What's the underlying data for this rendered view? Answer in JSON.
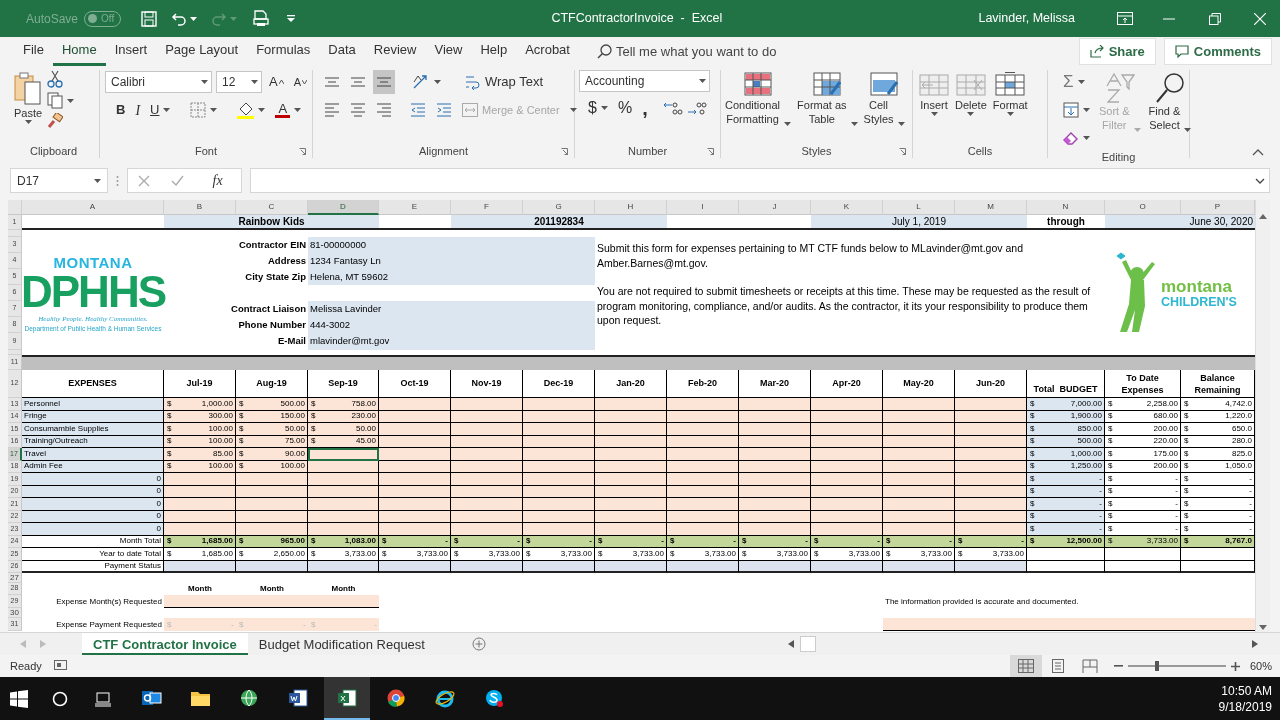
{
  "title_bar": {
    "autosave_label": "AutoSave",
    "autosave_toggle": "Off",
    "autosave_on": false,
    "title": "CTFContractorInvoice  -  Excel",
    "user": "Lavinder, Melissa"
  },
  "ribbon_tabs": [
    {
      "label": "File",
      "selected": false
    },
    {
      "label": "Home",
      "selected": true
    },
    {
      "label": "Insert",
      "selected": false
    },
    {
      "label": "Page Layout",
      "selected": false
    },
    {
      "label": "Formulas",
      "selected": false
    },
    {
      "label": "Data",
      "selected": false
    },
    {
      "label": "Review",
      "selected": false
    },
    {
      "label": "View",
      "selected": false
    },
    {
      "label": "Help",
      "selected": false
    },
    {
      "label": "Acrobat",
      "selected": false
    }
  ],
  "tell_me": {
    "placeholder": "Tell me what you want to do"
  },
  "share": "Share",
  "comments": "Comments",
  "clipboard": {
    "paste": "Paste",
    "label": "Clipboard"
  },
  "font": {
    "name": "Calibri",
    "size": "12",
    "grow": "A",
    "shrink": "A",
    "bold": "B",
    "italic": "I",
    "underline": "U",
    "color_letter": "A",
    "label": "Font"
  },
  "alignment": {
    "vertical": [
      {
        "selected": false
      },
      {
        "selected": false
      },
      {
        "selected": true
      }
    ],
    "wrap_text": "Wrap Text",
    "merge_center": {
      "label": "Merge & Center",
      "disabled": true
    },
    "label": "Alignment"
  },
  "number": {
    "format": "Accounting",
    "currency": "$",
    "percent": "%",
    "comma": ",",
    "label": "Number"
  },
  "styles": {
    "buttons": [
      {
        "kind": "conditional",
        "lines": [
          "Conditional",
          "Formatting"
        ]
      },
      {
        "kind": "table",
        "lines": [
          "Format as",
          "Table"
        ]
      },
      {
        "kind": "cell",
        "lines": [
          "Cell",
          "Styles"
        ]
      }
    ],
    "label": "Styles"
  },
  "cells": {
    "buttons": [
      {
        "kind": "insert",
        "label": "Insert"
      },
      {
        "kind": "delete",
        "label": "Delete"
      },
      {
        "kind": "format",
        "label": "Format"
      }
    ],
    "label": "Cells"
  },
  "editing": {
    "sum": "Σ",
    "sort_filter": {
      "lines": [
        "Sort &",
        "Filter"
      ],
      "disabled": true
    },
    "find_select": {
      "lines": [
        "Find &",
        "Select"
      ],
      "disabled": false
    },
    "label": "Editing"
  },
  "formula_bar": {
    "name_box": "D17",
    "fx": "fx"
  },
  "columns": [
    {
      "letter": "A",
      "selected": false
    },
    {
      "letter": "B",
      "selected": false
    },
    {
      "letter": "C",
      "selected": false
    },
    {
      "letter": "D",
      "selected": true
    },
    {
      "letter": "E",
      "selected": false
    },
    {
      "letter": "F",
      "selected": false
    },
    {
      "letter": "G",
      "selected": false
    },
    {
      "letter": "H",
      "selected": false
    },
    {
      "letter": "I",
      "selected": false
    },
    {
      "letter": "J",
      "selected": false
    },
    {
      "letter": "K",
      "selected": false
    },
    {
      "letter": "L",
      "selected": false
    },
    {
      "letter": "M",
      "selected": false
    },
    {
      "letter": "N",
      "selected": false
    },
    {
      "letter": "O",
      "selected": false
    },
    {
      "letter": "P",
      "selected": false
    }
  ],
  "row_headers": [
    {
      "label": "1",
      "selected": false
    },
    {
      "label": "3",
      "selected": false
    },
    {
      "label": "4",
      "selected": false
    },
    {
      "label": "5",
      "selected": false
    },
    {
      "label": "6",
      "selected": false
    },
    {
      "label": "7",
      "selected": false
    },
    {
      "label": "8",
      "selected": false
    },
    {
      "label": "9",
      "selected": false
    },
    {
      "label": "11",
      "selected": false
    },
    {
      "label": "12",
      "selected": false
    },
    {
      "label": "13",
      "selected": false
    },
    {
      "label": "14",
      "selected": false
    },
    {
      "label": "15",
      "selected": false
    },
    {
      "label": "16",
      "selected": false
    },
    {
      "label": "17",
      "selected": true
    },
    {
      "label": "18",
      "selected": false
    },
    {
      "label": "19",
      "selected": false
    },
    {
      "label": "20",
      "selected": false
    },
    {
      "label": "21",
      "selected": false
    },
    {
      "label": "22",
      "selected": false
    },
    {
      "label": "23",
      "selected": false
    },
    {
      "label": "24",
      "selected": false
    },
    {
      "label": "25",
      "selected": false
    },
    {
      "label": "26",
      "selected": false
    },
    {
      "label": "27",
      "selected": false
    },
    {
      "label": "28",
      "selected": false
    },
    {
      "label": "29",
      "selected": false
    },
    {
      "label": "30",
      "selected": false
    },
    {
      "label": "31",
      "selected": false
    }
  ],
  "header_row": {
    "organization": "Rainbow Kids",
    "contract_number": "201192834",
    "start_date": "July 1, 2019",
    "through": "through",
    "end_date": "June 30, 2020"
  },
  "dphhs_logo": {
    "top": "MONTANA",
    "main": "DPHHS",
    "tagline": "Healthy People. Healthy Communities.",
    "department": "Department of Public Health & Human Services"
  },
  "contractor_info": [
    {
      "label": "Contractor EIN",
      "value": "81-00000000"
    },
    {
      "label": "Address",
      "value": "1234 Fantasy Ln"
    },
    {
      "label": "City State Zip",
      "value": "Helena, MT 59602"
    },
    {
      "label": "Contract Liaison",
      "value": "Melissa Lavinder"
    },
    {
      "label": "Phone Number",
      "value": "444-3002"
    },
    {
      "label": "E-Mail",
      "value": "mlavinder@mt.gov"
    }
  ],
  "instructions": [
    "Submit this form for expenses pertaining to MT CTF funds below to MLavinder@mt.gov and Amber.Barnes@mt.gov.",
    "You are not required to submit timesheets or receipts at this time. These may be requested as the result of program monitoring, compliance, and/or audits. As the contractor, it its your responsibility to produce them upon request."
  ],
  "childrens_logo": {
    "top": "montana",
    "bottom": "CHILDREN'S"
  },
  "expenses": {
    "header": "EXPENSES",
    "months": [
      "Jul-19",
      "Aug-19",
      "Sep-19",
      "Oct-19",
      "Nov-19",
      "Dec-19",
      "Jan-20",
      "Feb-20",
      "Mar-20",
      "Apr-20",
      "May-20",
      "Jun-20"
    ],
    "budget_header": "Total  BUDGET",
    "to_date_header": "To Date Expenses",
    "balance_header": "Balance Remaining",
    "rows": [
      {
        "kind": "item",
        "name": "Personnel",
        "amounts": [
          [
            "$",
            "1,000.00"
          ],
          [
            "$",
            "500.00"
          ],
          [
            "$",
            "758.00"
          ]
        ],
        "budget": [
          "$",
          "7,000.00"
        ],
        "to_date": [
          "$",
          "2,258.00"
        ],
        "balance": [
          "$",
          "4,742.0"
        ]
      },
      {
        "kind": "item",
        "name": "Fringe",
        "amounts": [
          [
            "$",
            "300.00"
          ],
          [
            "$",
            "150.00"
          ],
          [
            "$",
            "230.00"
          ]
        ],
        "budget": [
          "$",
          "1,900.00"
        ],
        "to_date": [
          "$",
          "680.00"
        ],
        "balance": [
          "$",
          "1,220.0"
        ]
      },
      {
        "kind": "item",
        "name": "Consumamble Supplies",
        "amounts": [
          [
            "$",
            "100.00"
          ],
          [
            "$",
            "50.00"
          ],
          [
            "$",
            "50.00"
          ]
        ],
        "budget": [
          "$",
          "850.00"
        ],
        "to_date": [
          "$",
          "200.00"
        ],
        "balance": [
          "$",
          "650.0"
        ]
      },
      {
        "kind": "item",
        "name": "Training/Outreach",
        "amounts": [
          [
            "$",
            "100.00"
          ],
          [
            "$",
            "75.00"
          ],
          [
            "$",
            "45.00"
          ]
        ],
        "budget": [
          "$",
          "500.00"
        ],
        "to_date": [
          "$",
          "220.00"
        ],
        "balance": [
          "$",
          "280.0"
        ]
      },
      {
        "kind": "item",
        "name": "Travel",
        "amounts": [
          [
            "$",
            "85.00"
          ],
          [
            "$",
            "90.00"
          ]
        ],
        "budget": [
          "$",
          "1,000.00"
        ],
        "to_date": [
          "$",
          "175.00"
        ],
        "balance": [
          "$",
          "825.0"
        ]
      },
      {
        "kind": "item",
        "name": "Admin Fee",
        "amounts": [
          [
            "$",
            "100.00"
          ],
          [
            "$",
            "100.00"
          ]
        ],
        "budget": [
          "$",
          "1,250.00"
        ],
        "to_date": [
          "$",
          "200.00"
        ],
        "balance": [
          "$",
          "1,050.0"
        ]
      },
      {
        "kind": "placeholder",
        "name": "0",
        "amounts": [],
        "budget": [
          "$",
          "-"
        ],
        "to_date": [
          "$",
          "-"
        ],
        "balance": [
          "$",
          "-"
        ]
      },
      {
        "kind": "placeholder",
        "name": "0",
        "amounts": [],
        "budget": [
          "$",
          "-"
        ],
        "to_date": [
          "$",
          "-"
        ],
        "balance": [
          "$",
          "-"
        ]
      },
      {
        "kind": "placeholder",
        "name": "0",
        "amounts": [],
        "budget": [
          "$",
          "-"
        ],
        "to_date": [
          "$",
          "-"
        ],
        "balance": [
          "$",
          "-"
        ]
      },
      {
        "kind": "placeholder",
        "name": "0",
        "amounts": [],
        "budget": [
          "$",
          "-"
        ],
        "to_date": [
          "$",
          "-"
        ],
        "balance": [
          "$",
          "-"
        ]
      },
      {
        "kind": "placeholder",
        "name": "0",
        "amounts": [],
        "budget": [
          "$",
          "-"
        ],
        "to_date": [
          "$",
          "-"
        ],
        "balance": [
          "$",
          "-"
        ]
      }
    ],
    "month_total": {
      "label": "Month Total",
      "amounts": [
        [
          "$",
          "1,685.00"
        ],
        [
          "$",
          "965.00"
        ],
        [
          "$",
          "1,083.00"
        ],
        [
          "$",
          "-"
        ],
        [
          "$",
          "-"
        ],
        [
          "$",
          "-"
        ],
        [
          "$",
          "-"
        ],
        [
          "$",
          "-"
        ],
        [
          "$",
          "-"
        ],
        [
          "$",
          "-"
        ],
        [
          "$",
          "-"
        ],
        [
          "$",
          "-"
        ]
      ],
      "budget": [
        "$",
        "12,500.00"
      ],
      "to_date": [
        "$",
        "3,733.00"
      ],
      "balance": [
        "$",
        "8,767.0"
      ]
    },
    "year_to_date": {
      "label": "Year to date Total",
      "amounts": [
        [
          "$",
          "1,685.00"
        ],
        [
          "$",
          "2,650.00"
        ],
        [
          "$",
          "3,733.00"
        ],
        [
          "$",
          "3,733.00"
        ],
        [
          "$",
          "3,733.00"
        ],
        [
          "$",
          "3,733.00"
        ],
        [
          "$",
          "3,733.00"
        ],
        [
          "$",
          "3,733.00"
        ],
        [
          "$",
          "3,733.00"
        ],
        [
          "$",
          "3,733.00"
        ],
        [
          "$",
          "3,733.00"
        ],
        [
          "$",
          "3,733.00"
        ]
      ]
    },
    "payment_status": {
      "label": "Payment Status"
    }
  },
  "request": {
    "month_headers": [
      "Month",
      "Month",
      "Month"
    ],
    "months_label": "Expense Month(s) Requested",
    "payment_label": "Expense Payment Requested",
    "payments": [
      [
        "$",
        "-"
      ],
      [
        "$",
        "-"
      ],
      [
        "$",
        "-"
      ]
    ],
    "certification": "The information provided is accurate and documented."
  },
  "sheet_tabs": [
    {
      "label": "CTF Contractor Invoice",
      "selected": true
    },
    {
      "label": "Budget Modification Request",
      "selected": false
    }
  ],
  "status_bar": {
    "mode": "Ready",
    "views": [
      {
        "kind": "normal",
        "selected": true
      },
      {
        "kind": "page_layout",
        "selected": false
      },
      {
        "kind": "page_break",
        "selected": false
      }
    ],
    "zoom": {
      "level": 0.3,
      "reading": "60%"
    }
  },
  "taskbar": {
    "apps": [
      {
        "kind": "mail",
        "selected": false
      },
      {
        "kind": "folder",
        "selected": false
      },
      {
        "kind": "globe",
        "selected": false
      },
      {
        "kind": "word",
        "selected": false
      },
      {
        "kind": "excel",
        "selected": true
      },
      {
        "kind": "chrome",
        "selected": false
      },
      {
        "kind": "ie",
        "selected": false
      },
      {
        "kind": "skype",
        "selected": false
      }
    ],
    "time": "10:50 AM",
    "date": "9/18/2019"
  }
}
